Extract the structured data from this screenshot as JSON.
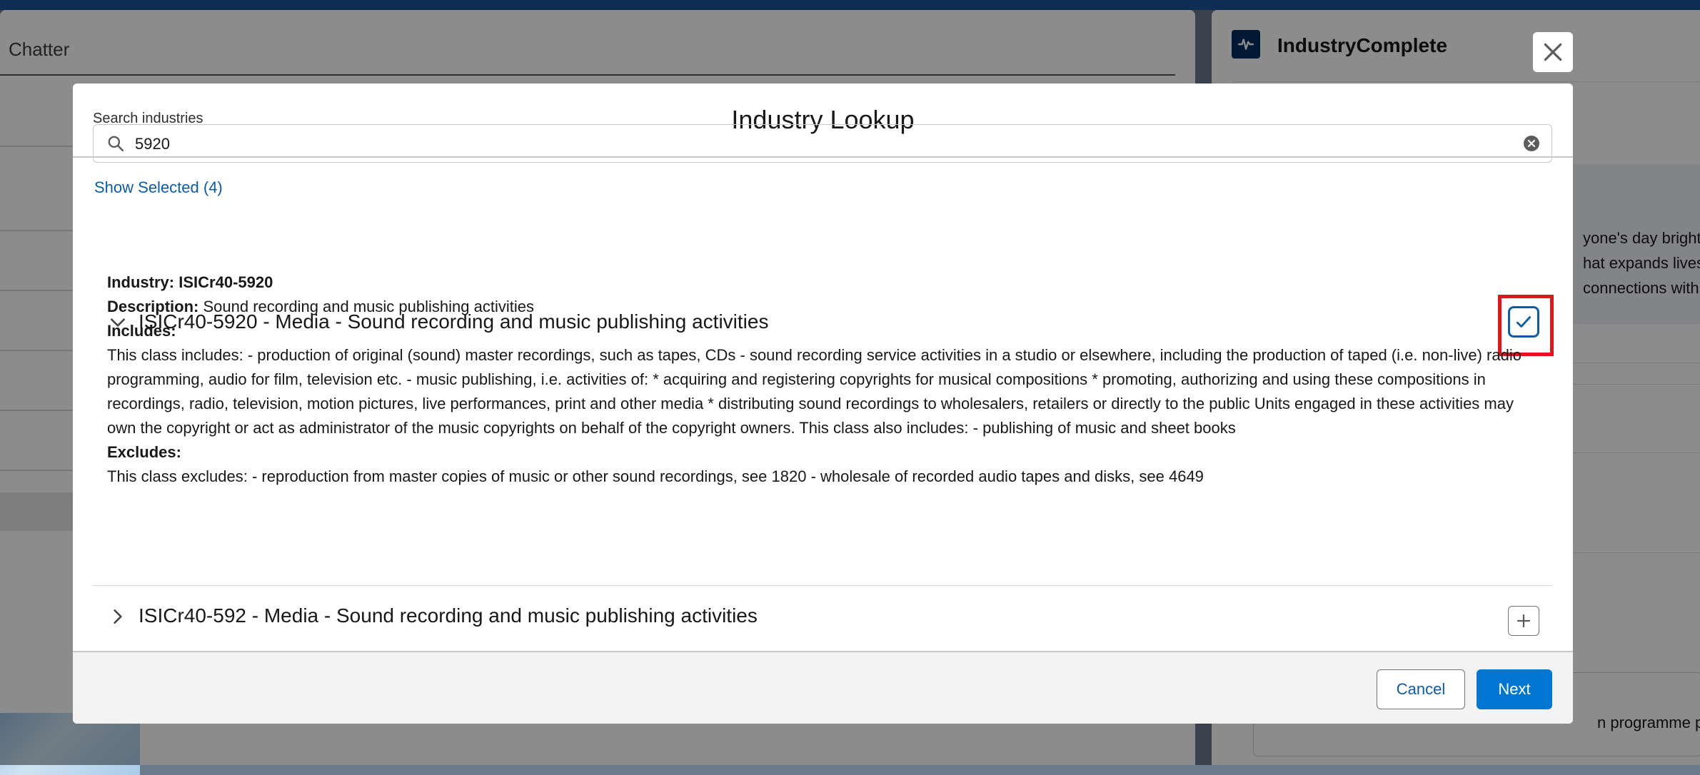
{
  "background": {
    "left_panel": {
      "title": "Chatter"
    },
    "right_panel": {
      "app_name": "IndustryComplete",
      "promo_lines": [
        "yone's day brighte",
        "hat expands lives.",
        "connections with"
      ],
      "footer_text": "n programme proc"
    }
  },
  "modal": {
    "title": "Industry Lookup",
    "search": {
      "label": "Search industries",
      "value": "5920",
      "placeholder": ""
    },
    "show_selected": "Show Selected (4)",
    "results": [
      {
        "title": "ISICr40-5920 - Media - Sound recording and music publishing activities",
        "expanded": true,
        "selected": true,
        "industry_label": "Industry:",
        "industry_value": "ISICr40-5920",
        "description_label": "Description:",
        "description_value": "Sound recording and music publishing activities",
        "includes_label": "Includes:",
        "includes_text": "This class includes: - production of original (sound) master recordings, such as tapes, CDs - sound recording service activities in a studio or elsewhere, including the production of taped (i.e. non-live) radio programming, audio for film, television etc. - music publishing, i.e. activities of: * acquiring and registering copyrights for musical compositions * promoting, authorizing and using these compositions in recordings, radio, television, motion pictures, live performances, print and other media * distributing sound recordings to wholesalers, retailers or directly to the public Units engaged in these activities may own the copyright or act as administrator of the music copyrights on behalf of the copyright owners. This class also includes: - publishing of music and sheet books",
        "excludes_label": "Excludes:",
        "excludes_text": "This class excludes: - reproduction from master copies of music or other sound recordings, see 1820 - wholesale of recorded audio tapes and disks, see 4649"
      },
      {
        "title": "ISICr40-592 - Media - Sound recording and music publishing activities",
        "expanded": false,
        "selected": false
      }
    ],
    "footer": {
      "cancel_label": "Cancel",
      "next_label": "Next"
    }
  },
  "colors": {
    "brand_blue": "#0176d3",
    "link_blue": "#0b5cab",
    "highlight_red": "#e3141b",
    "app_icon_bg": "#032d60"
  },
  "icons": {
    "close": "close-icon",
    "search": "search-icon",
    "clear": "clear-icon",
    "expand": "chevron-down-icon",
    "collapse": "chevron-right-icon",
    "checked": "check-icon",
    "add": "plus-icon",
    "app": "pulse-icon"
  }
}
